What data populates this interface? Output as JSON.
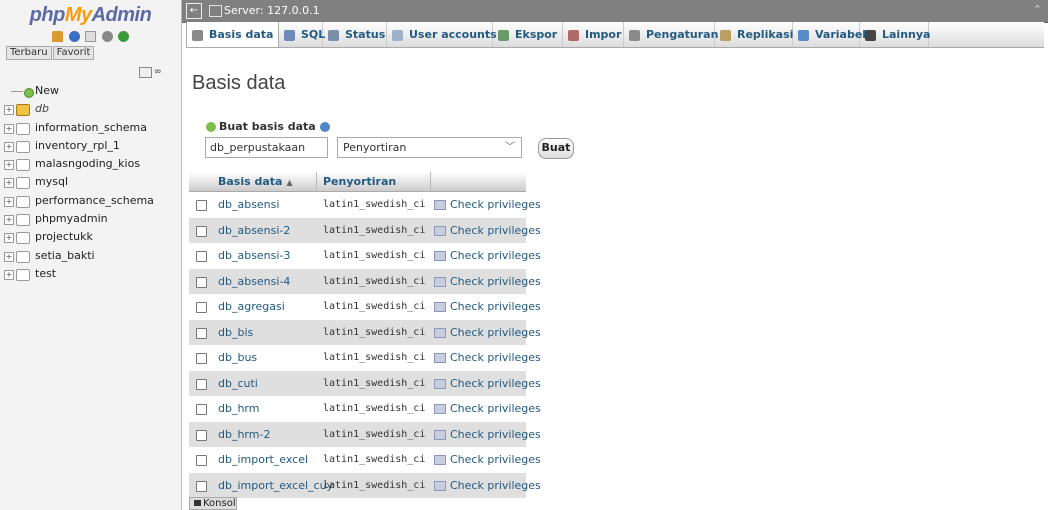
{
  "left": {
    "logo": {
      "php": "php",
      "my": "My",
      "admin": "Admin"
    },
    "recent_tab": "Terbaru",
    "favorite_tab": "Favorit",
    "tree": [
      {
        "label": "New",
        "kind": "new"
      },
      {
        "label": "db",
        "kind": "current"
      },
      {
        "label": "information_schema",
        "kind": "db"
      },
      {
        "label": "inventory_rpl_1",
        "kind": "db"
      },
      {
        "label": "malasngoding_kios",
        "kind": "db"
      },
      {
        "label": "mysql",
        "kind": "db"
      },
      {
        "label": "performance_schema",
        "kind": "db"
      },
      {
        "label": "phpmyadmin",
        "kind": "db"
      },
      {
        "label": "projectukk",
        "kind": "db"
      },
      {
        "label": "setia_bakti",
        "kind": "db"
      },
      {
        "label": "test",
        "kind": "db"
      }
    ]
  },
  "topbar": {
    "server": "Server: 127.0.0.1"
  },
  "menu": [
    {
      "label": "Basis data",
      "icon": "database-icon",
      "color": "#8a8a8a"
    },
    {
      "label": "SQL",
      "icon": "sql-icon",
      "color": "#6f8ab8"
    },
    {
      "label": "Status",
      "icon": "status-icon",
      "color": "#7a8fa8"
    },
    {
      "label": "User accounts",
      "icon": "users-icon",
      "color": "#9fb0c8"
    },
    {
      "label": "Ekspor",
      "icon": "export-icon",
      "color": "#6a9a6a"
    },
    {
      "label": "Impor",
      "icon": "import-icon",
      "color": "#b06a6a"
    },
    {
      "label": "Pengaturan",
      "icon": "wrench-icon",
      "color": "#8a8a8a"
    },
    {
      "label": "Replikasi",
      "icon": "replication-icon",
      "color": "#b8a060"
    },
    {
      "label": "Variabel",
      "icon": "variables-icon",
      "color": "#5a8ac8"
    },
    {
      "label": "Lainnya",
      "icon": "more-icon",
      "color": "#444444"
    }
  ],
  "main": {
    "title": "Basis data",
    "create": {
      "label": "Buat basis data",
      "db_name_value": "db_perpustakaan",
      "collation_value": "Penyortiran",
      "button": "Buat"
    },
    "table": {
      "headers": [
        "Basis data",
        "Penyortiran"
      ],
      "rows": [
        {
          "name": "db_absensi",
          "collation": "latin1_swedish_ci",
          "action": "Check privileges"
        },
        {
          "name": "db_absensi-2",
          "collation": "latin1_swedish_ci",
          "action": "Check privileges"
        },
        {
          "name": "db_absensi-3",
          "collation": "latin1_swedish_ci",
          "action": "Check privileges"
        },
        {
          "name": "db_absensi-4",
          "collation": "latin1_swedish_ci",
          "action": "Check privileges"
        },
        {
          "name": "db_agregasi",
          "collation": "latin1_swedish_ci",
          "action": "Check privileges"
        },
        {
          "name": "db_bis",
          "collation": "latin1_swedish_ci",
          "action": "Check privileges"
        },
        {
          "name": "db_bus",
          "collation": "latin1_swedish_ci",
          "action": "Check privileges"
        },
        {
          "name": "db_cuti",
          "collation": "latin1_swedish_ci",
          "action": "Check privileges"
        },
        {
          "name": "db_hrm",
          "collation": "latin1_swedish_ci",
          "action": "Check privileges"
        },
        {
          "name": "db_hrm-2",
          "collation": "latin1_swedish_ci",
          "action": "Check privileges"
        },
        {
          "name": "db_import_excel",
          "collation": "latin1_swedish_ci",
          "action": "Check privileges"
        },
        {
          "name": "db_import_excel_cuy",
          "collation": "latin1_swedish_ci",
          "action": "Check privileges"
        }
      ]
    }
  },
  "console": {
    "label": "Konsol"
  }
}
